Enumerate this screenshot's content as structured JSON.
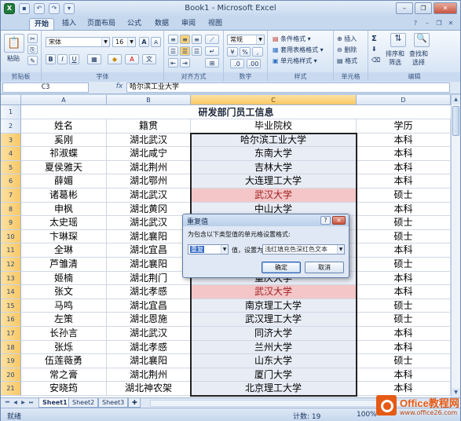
{
  "window": {
    "title": "Book1 - Microsoft Excel"
  },
  "tabs": [
    "开始",
    "插入",
    "页面布局",
    "公式",
    "数据",
    "审阅",
    "视图"
  ],
  "ribbon": {
    "clipboard": {
      "paste": "粘贴",
      "label": "剪贴板"
    },
    "font": {
      "name": "宋体",
      "size": "16",
      "bold": "B",
      "italic": "I",
      "underline": "U",
      "grow": "A",
      "shrink": "A",
      "label": "字体"
    },
    "alignment": {
      "label": "对齐方式"
    },
    "number": {
      "format": "常规",
      "percent": "%",
      "comma": ",",
      "label": "数字"
    },
    "styles": {
      "conditional": "条件格式",
      "table": "套用表格格式",
      "cell": "单元格样式",
      "label": "样式"
    },
    "cells": {
      "insert": "插入",
      "delete": "删除",
      "format": "格式",
      "label": "单元格"
    },
    "editing": {
      "sum": "Σ",
      "sort": "排序和\n筛选",
      "find": "查找和\n选择",
      "label": "编辑"
    }
  },
  "formula_bar": {
    "name_box": "C3",
    "fx": "fx",
    "content": "哈尔滨工业大学"
  },
  "sheet": {
    "columns": [
      "A",
      "B",
      "C",
      "D"
    ],
    "title": "研发部门员工信息",
    "headers": [
      "姓名",
      "籍贯",
      "毕业院校",
      "学历"
    ],
    "rows": [
      [
        "奚刚",
        "湖北武汉",
        "哈尔滨工业大学",
        "本科"
      ],
      [
        "祁淑蝶",
        "湖北咸宁",
        "东南大学",
        "本科"
      ],
      [
        "夏侯雅天",
        "湖北荆州",
        "吉林大学",
        "本科"
      ],
      [
        "薛媚",
        "湖北鄂州",
        "大连理工大学",
        "本科"
      ],
      [
        "诸葛彬",
        "湖北武汉",
        "武汉大学",
        "硕士"
      ],
      [
        "申枫",
        "湖北黄冈",
        "中山大学",
        "本科"
      ],
      [
        "太史瑶",
        "湖北武汉",
        "",
        "硕士"
      ],
      [
        "卞琳琛",
        "湖北襄阳",
        "",
        "硕士"
      ],
      [
        "全琳",
        "湖北宜昌",
        "",
        "本科"
      ],
      [
        "芦雏清",
        "湖北襄阳",
        "",
        "硕士"
      ],
      [
        "姬楠",
        "湖北荆门",
        "重庆大学",
        "本科"
      ],
      [
        "张文",
        "湖北孝感",
        "武汉大学",
        "本科"
      ],
      [
        "马鸣",
        "湖北宜昌",
        "南京理工大学",
        "硕士"
      ],
      [
        "左策",
        "湖北恩施",
        "武汉理工大学",
        "硕士"
      ],
      [
        "长孙言",
        "湖北武汉",
        "同济大学",
        "本科"
      ],
      [
        "张烁",
        "湖北孝感",
        "兰州大学",
        "本科"
      ],
      [
        "伍莲薇勇",
        "湖北襄阳",
        "山东大学",
        "硕士"
      ],
      [
        "常之膏",
        "湖北荆州",
        "厦门大学",
        "本科"
      ],
      [
        "安晓筠",
        "湖北神农架",
        "北京理工大学",
        "本科"
      ]
    ],
    "row_numbers": [
      "1",
      "2",
      "3",
      "4",
      "5",
      "6",
      "7",
      "8",
      "9",
      "10",
      "11",
      "12",
      "13",
      "14",
      "15",
      "16",
      "17",
      "18",
      "19",
      "20",
      "21"
    ]
  },
  "sheet_tabs": [
    "Sheet1",
    "Sheet2",
    "Sheet3"
  ],
  "status": {
    "ready": "就绪",
    "count": "计数: 19",
    "zoom": "100%"
  },
  "dialog": {
    "title": "重复值",
    "help": "?",
    "close": "×",
    "message": "为包含以下类型值的单元格设置格式:",
    "type_value": "重复",
    "mid_text": "值，设置为",
    "format_value": "浅红填充色深红色文本",
    "ok": "确定",
    "cancel": "取消"
  },
  "watermark": {
    "brand": "Office教程网",
    "url": "www.office26.com"
  },
  "colors": {
    "duplicate_fill": "#f4c6c8",
    "duplicate_text": "#9c1c1c",
    "selection_fill": "#e8ecf5"
  }
}
